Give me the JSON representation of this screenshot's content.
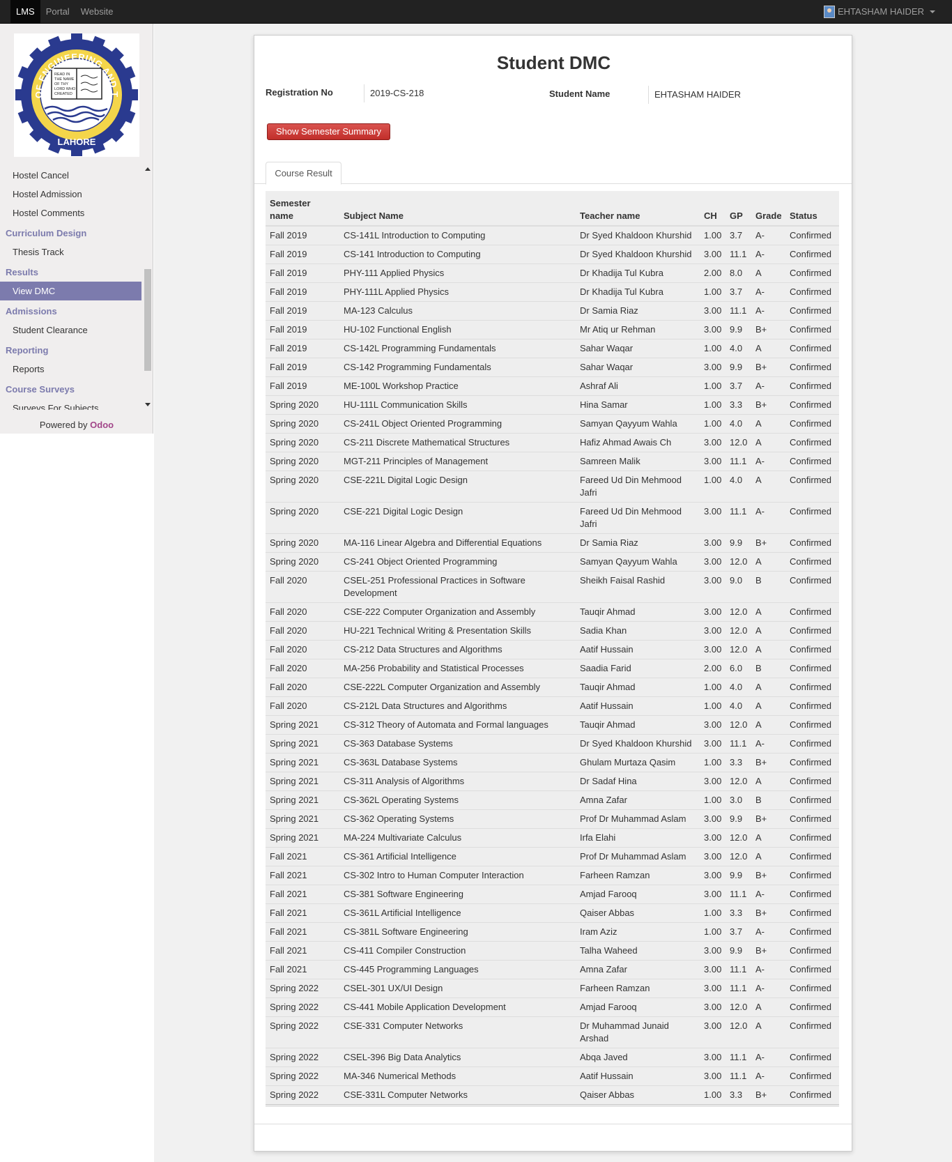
{
  "navbar": {
    "items": [
      "LMS",
      "Portal",
      "Website"
    ],
    "user": "EHTASHAM HAIDER"
  },
  "sidebar": {
    "logo": {
      "text_top": "UNIVERSITY OF ENGINEERING AND TECHNOLOGY",
      "text_bottom": "LAHORE",
      "book_text": "READ IN THE NAME OF THY LORD WHO CREATED"
    },
    "menu": [
      {
        "type": "item",
        "label": "Hostel Cancel"
      },
      {
        "type": "item",
        "label": "Hostel Admission"
      },
      {
        "type": "item",
        "label": "Hostel Comments"
      },
      {
        "type": "header",
        "label": "Curriculum Design"
      },
      {
        "type": "item",
        "label": "Thesis Track"
      },
      {
        "type": "header",
        "label": "Results"
      },
      {
        "type": "item",
        "label": "View DMC",
        "active": true
      },
      {
        "type": "header",
        "label": "Admissions"
      },
      {
        "type": "item",
        "label": "Student Clearance"
      },
      {
        "type": "header",
        "label": "Reporting"
      },
      {
        "type": "item",
        "label": "Reports"
      },
      {
        "type": "header",
        "label": "Course Surveys"
      },
      {
        "type": "item",
        "label": "Surveys For Subjects"
      }
    ],
    "powered_by": "Powered by",
    "brand": "Odoo"
  },
  "page": {
    "title": "Student DMC",
    "registration_label": "Registration No",
    "registration_value": "2019-CS-218",
    "student_name_label": "Student Name",
    "student_name_value": "EHTASHAM HAIDER",
    "summary_button": "Show Semester Summary",
    "tab": "Course Result"
  },
  "table": {
    "headers": [
      "Semester name",
      "Subject Name",
      "Teacher name",
      "CH",
      "GP",
      "Grade",
      "Status"
    ],
    "rows": [
      [
        "Fall 2019",
        "CS-141L Introduction to Computing",
        "Dr Syed Khaldoon Khurshid",
        "1.00",
        "3.7",
        "A-",
        "Confirmed"
      ],
      [
        "Fall 2019",
        "CS-141 Introduction to Computing",
        "Dr Syed Khaldoon Khurshid",
        "3.00",
        "11.1",
        "A-",
        "Confirmed"
      ],
      [
        "Fall 2019",
        "PHY-111 Applied Physics",
        "Dr Khadija Tul Kubra",
        "2.00",
        "8.0",
        "A",
        "Confirmed"
      ],
      [
        "Fall 2019",
        "PHY-111L Applied Physics",
        "Dr Khadija Tul Kubra",
        "1.00",
        "3.7",
        "A-",
        "Confirmed"
      ],
      [
        "Fall 2019",
        "MA-123 Calculus",
        "Dr Samia Riaz",
        "3.00",
        "11.1",
        "A-",
        "Confirmed"
      ],
      [
        "Fall 2019",
        "HU-102 Functional English",
        "Mr Atiq ur Rehman",
        "3.00",
        "9.9",
        "B+",
        "Confirmed"
      ],
      [
        "Fall 2019",
        "CS-142L Programming Fundamentals",
        "Sahar Waqar",
        "1.00",
        "4.0",
        "A",
        "Confirmed"
      ],
      [
        "Fall 2019",
        "CS-142 Programming Fundamentals",
        "Sahar Waqar",
        "3.00",
        "9.9",
        "B+",
        "Confirmed"
      ],
      [
        "Fall 2019",
        "ME-100L Workshop Practice",
        "Ashraf Ali",
        "1.00",
        "3.7",
        "A-",
        "Confirmed"
      ],
      [
        "Spring 2020",
        "HU-111L Communication Skills",
        "Hina Samar",
        "1.00",
        "3.3",
        "B+",
        "Confirmed"
      ],
      [
        "Spring 2020",
        "CS-241L Object Oriented Programming",
        "Samyan Qayyum Wahla",
        "1.00",
        "4.0",
        "A",
        "Confirmed"
      ],
      [
        "Spring 2020",
        "CS-211 Discrete Mathematical Structures",
        "Hafiz Ahmad Awais Ch",
        "3.00",
        "12.0",
        "A",
        "Confirmed"
      ],
      [
        "Spring 2020",
        "MGT-211 Principles of Management",
        "Samreen Malik",
        "3.00",
        "11.1",
        "A-",
        "Confirmed"
      ],
      [
        "Spring 2020",
        "CSE-221L Digital Logic Design",
        "Fareed Ud Din Mehmood Jafri",
        "1.00",
        "4.0",
        "A",
        "Confirmed"
      ],
      [
        "Spring 2020",
        "CSE-221 Digital Logic Design",
        "Fareed Ud Din Mehmood Jafri",
        "3.00",
        "11.1",
        "A-",
        "Confirmed"
      ],
      [
        "Spring 2020",
        "MA-116 Linear Algebra and Differential Equations",
        "Dr Samia Riaz",
        "3.00",
        "9.9",
        "B+",
        "Confirmed"
      ],
      [
        "Spring 2020",
        "CS-241 Object Oriented Programming",
        "Samyan Qayyum Wahla",
        "3.00",
        "12.0",
        "A",
        "Confirmed"
      ],
      [
        "Fall 2020",
        "CSEL-251 Professional Practices in Software Development",
        "Sheikh Faisal Rashid",
        "3.00",
        "9.0",
        "B",
        "Confirmed"
      ],
      [
        "Fall 2020",
        "CSE-222 Computer Organization and Assembly",
        "Tauqir Ahmad",
        "3.00",
        "12.0",
        "A",
        "Confirmed"
      ],
      [
        "Fall 2020",
        "HU-221 Technical Writing & Presentation Skills",
        "Sadia Khan",
        "3.00",
        "12.0",
        "A",
        "Confirmed"
      ],
      [
        "Fall 2020",
        "CS-212 Data Structures and Algorithms",
        "Aatif Hussain",
        "3.00",
        "12.0",
        "A",
        "Confirmed"
      ],
      [
        "Fall 2020",
        "MA-256 Probability and Statistical Processes",
        "Saadia Farid",
        "2.00",
        "6.0",
        "B",
        "Confirmed"
      ],
      [
        "Fall 2020",
        "CSE-222L Computer Organization and Assembly",
        "Tauqir Ahmad",
        "1.00",
        "4.0",
        "A",
        "Confirmed"
      ],
      [
        "Fall 2020",
        "CS-212L Data Structures and Algorithms",
        "Aatif Hussain",
        "1.00",
        "4.0",
        "A",
        "Confirmed"
      ],
      [
        "Spring 2021",
        "CS-312 Theory of Automata and Formal languages",
        "Tauqir Ahmad",
        "3.00",
        "12.0",
        "A",
        "Confirmed"
      ],
      [
        "Spring 2021",
        "CS-363 Database Systems",
        "Dr Syed Khaldoon Khurshid",
        "3.00",
        "11.1",
        "A-",
        "Confirmed"
      ],
      [
        "Spring 2021",
        "CS-363L Database Systems",
        "Ghulam Murtaza Qasim",
        "1.00",
        "3.3",
        "B+",
        "Confirmed"
      ],
      [
        "Spring 2021",
        "CS-311 Analysis of Algorithms",
        "Dr Sadaf Hina",
        "3.00",
        "12.0",
        "A",
        "Confirmed"
      ],
      [
        "Spring 2021",
        "CS-362L Operating Systems",
        "Amna Zafar",
        "1.00",
        "3.0",
        "B",
        "Confirmed"
      ],
      [
        "Spring 2021",
        "CS-362 Operating Systems",
        "Prof Dr Muhammad Aslam",
        "3.00",
        "9.9",
        "B+",
        "Confirmed"
      ],
      [
        "Spring 2021",
        "MA-224 Multivariate Calculus",
        "Irfa Elahi",
        "3.00",
        "12.0",
        "A",
        "Confirmed"
      ],
      [
        "Fall 2021",
        "CS-361 Artificial Intelligence",
        "Prof Dr Muhammad Aslam",
        "3.00",
        "12.0",
        "A",
        "Confirmed"
      ],
      [
        "Fall 2021",
        "CS-302 Intro to Human Computer Interaction",
        "Farheen Ramzan",
        "3.00",
        "9.9",
        "B+",
        "Confirmed"
      ],
      [
        "Fall 2021",
        "CS-381 Software Engineering",
        "Amjad Farooq",
        "3.00",
        "11.1",
        "A-",
        "Confirmed"
      ],
      [
        "Fall 2021",
        "CS-361L Artificial Intelligence",
        "Qaiser Abbas",
        "1.00",
        "3.3",
        "B+",
        "Confirmed"
      ],
      [
        "Fall 2021",
        "CS-381L Software Engineering",
        "Iram Aziz",
        "1.00",
        "3.7",
        "A-",
        "Confirmed"
      ],
      [
        "Fall 2021",
        "CS-411 Compiler Construction",
        "Talha Waheed",
        "3.00",
        "9.9",
        "B+",
        "Confirmed"
      ],
      [
        "Fall 2021",
        "CS-445 Programming Languages",
        "Amna Zafar",
        "3.00",
        "11.1",
        "A-",
        "Confirmed"
      ],
      [
        "Spring 2022",
        "CSEL-301 UX/UI Design",
        "Farheen Ramzan",
        "3.00",
        "11.1",
        "A-",
        "Confirmed"
      ],
      [
        "Spring 2022",
        "CS-441 Mobile Application Development",
        "Amjad Farooq",
        "3.00",
        "12.0",
        "A",
        "Confirmed"
      ],
      [
        "Spring 2022",
        "CSE-331 Computer Networks",
        "Dr Muhammad Junaid Arshad",
        "3.00",
        "12.0",
        "A",
        "Confirmed"
      ],
      [
        "Spring 2022",
        "CSEL-396 Big Data Analytics",
        "Abqa Javed",
        "3.00",
        "11.1",
        "A-",
        "Confirmed"
      ],
      [
        "Spring 2022",
        "MA-346 Numerical Methods",
        "Aatif Hussain",
        "3.00",
        "11.1",
        "A-",
        "Confirmed"
      ],
      [
        "Spring 2022",
        "CSE-331L Computer Networks",
        "Qaiser Abbas",
        "1.00",
        "3.3",
        "B+",
        "Confirmed"
      ]
    ]
  },
  "colors": {
    "navbar": "#222222",
    "sidebar_accent": "#7c7bad",
    "button_red": "#c9302c",
    "odoo_brand": "#a24689"
  }
}
